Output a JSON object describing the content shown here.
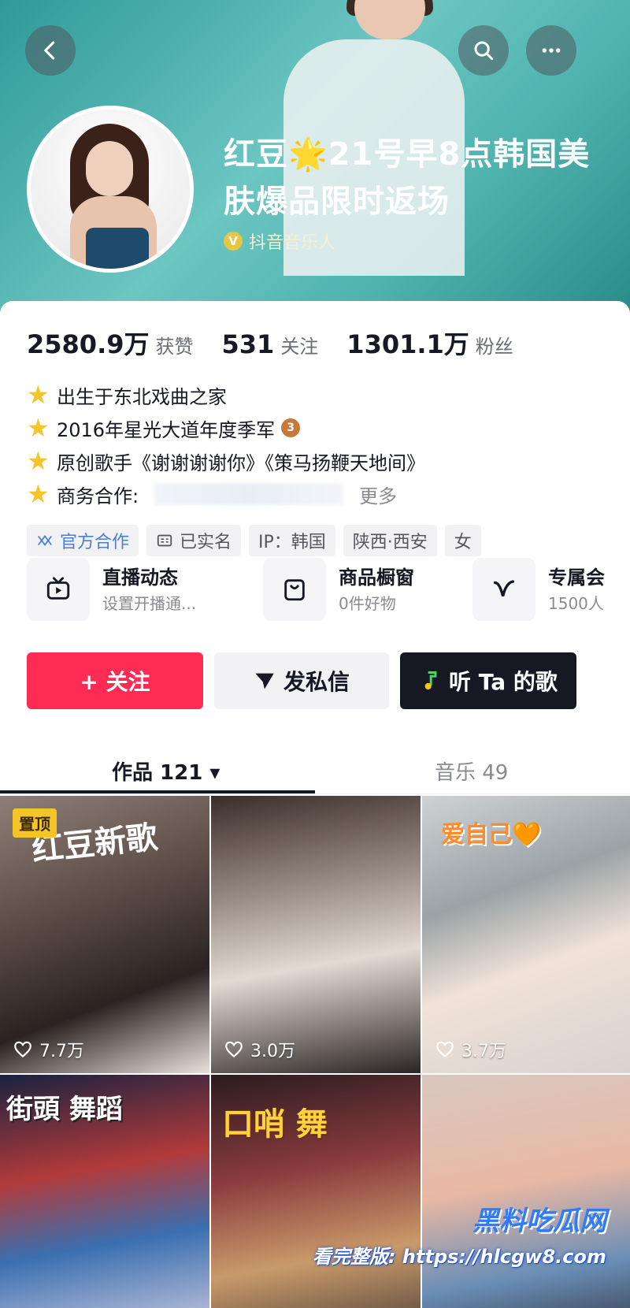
{
  "header": {
    "name": "红豆🌟21号早8点韩国美肤爆品限时返场",
    "verified_label": "抖音音乐人"
  },
  "stats": [
    {
      "value": "2580.9万",
      "label": "获赞"
    },
    {
      "value": "531",
      "label": "关注"
    },
    {
      "value": "1301.1万",
      "label": "粉丝"
    }
  ],
  "bio": {
    "line1": "出生于东北戏曲之家",
    "line2": "2016年星光大道年度季军",
    "line3": "原创歌手《谢谢谢谢你》《策马扬鞭天地间》",
    "line4": "商务合作:",
    "more": "更多",
    "medal": "3"
  },
  "tags": [
    "官方合作",
    "已实名",
    "IP：韩国",
    "陕西·西安",
    "女"
  ],
  "features": [
    {
      "title": "直播动态",
      "subtitle": "设置开播通..."
    },
    {
      "title": "商品橱窗",
      "subtitle": "0件好物"
    },
    {
      "title": "专属会",
      "subtitle": "1500人"
    }
  ],
  "actions": {
    "follow": "+ 关注",
    "message": "发私信",
    "listen": "听 Ta 的歌"
  },
  "tabs": {
    "works": "作品 121 ▾",
    "music": "音乐 49"
  },
  "videos": [
    {
      "pinned": "置顶",
      "overlay": "红豆新歌",
      "likes": "7.7万"
    },
    {
      "overlay": "",
      "likes": "3.0万"
    },
    {
      "overlay": "爱自己🧡",
      "likes": "3.7万"
    },
    {
      "overlay": "街頭 舞蹈",
      "likes": ""
    },
    {
      "overlay": "口哨 舞",
      "likes": ""
    },
    {
      "overlay": "",
      "likes": ""
    }
  ],
  "watermark": {
    "line1": "黑料吃瓜网",
    "line2": "看完整版: https://hlcgw8.com"
  },
  "colors": {
    "follow": "#fe2c55",
    "dark": "#161823",
    "hero": "#4fb3ae",
    "star": "#f5c427"
  }
}
